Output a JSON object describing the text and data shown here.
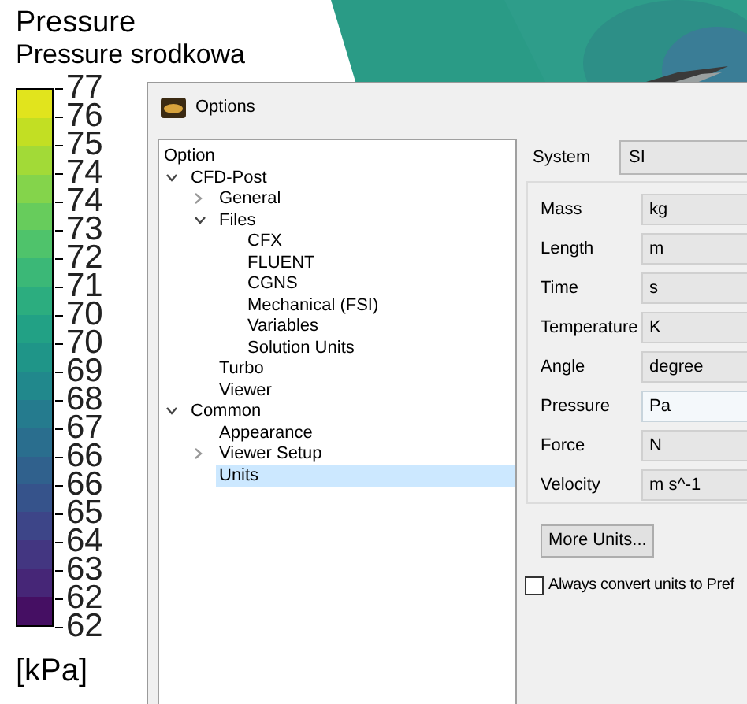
{
  "plot": {
    "title": "Pressure",
    "subtitle": "Pressure srodkowa",
    "unit": "[kPa]",
    "legend": {
      "ticks": [
        "77",
        "76",
        "75",
        "74",
        "74",
        "73",
        "72",
        "71",
        "70",
        "70",
        "69",
        "68",
        "67",
        "66",
        "66",
        "65",
        "64",
        "63",
        "62",
        "62"
      ],
      "bands": [
        {
          "color": "#e1e41d"
        },
        {
          "color": "#c2df23"
        },
        {
          "color": "#a2da37"
        },
        {
          "color": "#84d44b"
        },
        {
          "color": "#67cc5c"
        },
        {
          "color": "#4fc36b"
        },
        {
          "color": "#3bb877"
        },
        {
          "color": "#2cad7f"
        },
        {
          "color": "#22a185"
        },
        {
          "color": "#1f9588"
        },
        {
          "color": "#21888c"
        },
        {
          "color": "#257b8e"
        },
        {
          "color": "#2a6e8e"
        },
        {
          "color": "#30618d"
        },
        {
          "color": "#36538b"
        },
        {
          "color": "#3d4588"
        },
        {
          "color": "#433681"
        },
        {
          "color": "#462677"
        },
        {
          "color": "#450f63"
        }
      ]
    }
  },
  "window": {
    "title": "Options"
  },
  "tree": {
    "header": "Option",
    "items": [
      {
        "label": "CFD-Post",
        "kind": "group",
        "expanded": true,
        "selected": false,
        "children": [
          {
            "label": "General",
            "kind": "group",
            "expanded": false,
            "selected": false
          },
          {
            "label": "Files",
            "kind": "group",
            "expanded": true,
            "selected": false,
            "children": [
              {
                "label": "CFX",
                "kind": "leaf",
                "selected": false
              },
              {
                "label": "FLUENT",
                "kind": "leaf",
                "selected": false
              },
              {
                "label": "CGNS",
                "kind": "leaf",
                "selected": false
              },
              {
                "label": "Mechanical (FSI)",
                "kind": "leaf",
                "selected": false
              },
              {
                "label": "Variables",
                "kind": "leaf",
                "selected": false
              },
              {
                "label": "Solution Units",
                "kind": "leaf",
                "selected": false
              }
            ]
          },
          {
            "label": "Turbo",
            "kind": "leaf",
            "selected": false
          },
          {
            "label": "Viewer",
            "kind": "leaf",
            "selected": false
          }
        ]
      },
      {
        "label": "Common",
        "kind": "group",
        "expanded": true,
        "selected": false,
        "children": [
          {
            "label": "Appearance",
            "kind": "leaf",
            "selected": false
          },
          {
            "label": "Viewer Setup",
            "kind": "group",
            "expanded": false,
            "selected": false
          },
          {
            "label": "Units",
            "kind": "leaf",
            "selected": true
          }
        ]
      }
    ]
  },
  "system": {
    "label": "System",
    "value": "SI"
  },
  "units": [
    {
      "label": "Mass",
      "value": "kg",
      "focused": false
    },
    {
      "label": "Length",
      "value": "m",
      "focused": false
    },
    {
      "label": "Time",
      "value": "s",
      "focused": false
    },
    {
      "label": "Temperature",
      "value": "K",
      "focused": false
    },
    {
      "label": "Angle",
      "value": "degree",
      "focused": false
    },
    {
      "label": "Pressure",
      "value": "Pa",
      "focused": true
    },
    {
      "label": "Force",
      "value": "N",
      "focused": false
    },
    {
      "label": "Velocity",
      "value": "m s^-1",
      "focused": false
    }
  ],
  "more_button": "More Units...",
  "convert": {
    "label": "Always convert units to Pref",
    "checked": false
  }
}
